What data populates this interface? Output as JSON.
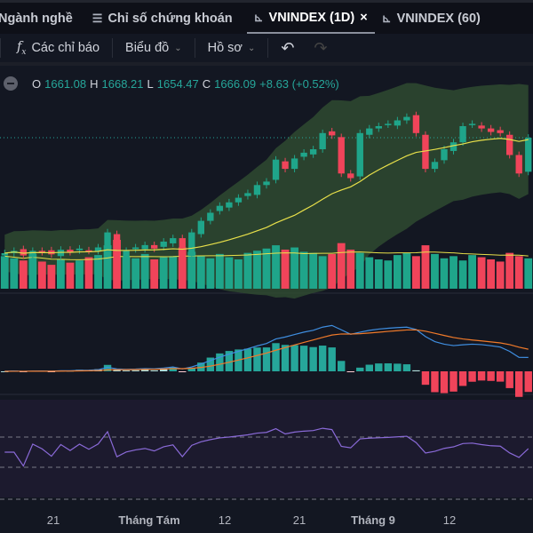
{
  "tabs": [
    {
      "label": "Ngành nghề",
      "icon": "none"
    },
    {
      "label": "Chỉ số chứng khoán",
      "icon": "list-icon"
    },
    {
      "label": "VNINDEX (1D)",
      "icon": "chart-icon",
      "active": true,
      "close": "×"
    },
    {
      "label": "VNINDEX (60)",
      "icon": "chart-icon"
    }
  ],
  "toolbar": {
    "indicators": "Các chỉ báo",
    "chart": "Biểu đồ",
    "profile": "Hồ sơ"
  },
  "legend": {
    "o_label": "O",
    "o": "1661.08",
    "h_label": "H",
    "h": "1668.21",
    "l_label": "L",
    "l": "1654.47",
    "c_label": "C",
    "c": "1666.09",
    "change": "+8.63 (+0.52%)"
  },
  "xaxis": [
    "21",
    "Tháng Tám",
    "12",
    "21",
    "Tháng 9",
    "12"
  ],
  "colors": {
    "up": "#1fa58a",
    "down": "#f0445a",
    "ma": "#e8e04a",
    "bb_fill": "#2f4a30",
    "macd": "#3f8ee0",
    "signal": "#f07a2a",
    "rsi": "#8a6ad8"
  },
  "chart_data": {
    "type": "candlestick",
    "symbol": "VNINDEX",
    "interval": "1D",
    "last_price": 1666.09,
    "close": [
      1566,
      1568,
      1564,
      1568,
      1567,
      1565,
      1569,
      1567,
      1570,
      1568,
      1571,
      1584,
      1562,
      1568,
      1571,
      1573,
      1570,
      1576,
      1579,
      1562,
      1584,
      1594,
      1601,
      1607,
      1610,
      1614,
      1618,
      1625,
      1628,
      1647,
      1639,
      1648,
      1653,
      1656,
      1670,
      1668,
      1635,
      1631,
      1670,
      1674,
      1676,
      1678,
      1681,
      1684,
      1670,
      1639,
      1645,
      1656,
      1662,
      1676,
      1678,
      1674,
      1671,
      1670,
      1651,
      1635,
      1666
    ],
    "volume": [
      30,
      28,
      26,
      32,
      25,
      22,
      27,
      24,
      26,
      29,
      31,
      40,
      45,
      30,
      28,
      32,
      27,
      29,
      30,
      38,
      34,
      30,
      28,
      32,
      29,
      27,
      33,
      35,
      37,
      40,
      36,
      38,
      34,
      33,
      30,
      32,
      42,
      36,
      33,
      29,
      27,
      26,
      31,
      33,
      30,
      40,
      32,
      28,
      30,
      26,
      31,
      29,
      27,
      25,
      33,
      30,
      28
    ],
    "rsi_levels": [
      70,
      30
    ]
  }
}
